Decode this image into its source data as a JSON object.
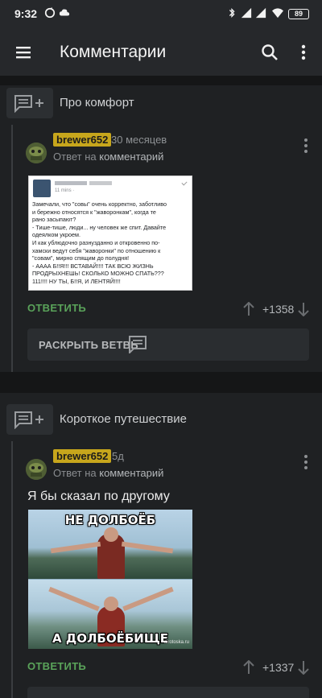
{
  "status_bar": {
    "time": "9:32",
    "battery": "89"
  },
  "app_bar": {
    "title": "Комментарии"
  },
  "threads": [
    {
      "topic": "Про комфорт",
      "comment": {
        "username": "brewer652",
        "time_ago": "30 месяцев",
        "reply_prefix": "Ответ на",
        "reply_target": "комментарий",
        "image": {
          "type": "screenshot-of-social-post",
          "post_time": "11 mins ·",
          "text_lines": [
            "Замечали, что \"совы\" очень корректно, заботливо",
            "и бережно относятся к \"жаворонкам\", когда те",
            "рано засыпают?",
            "- Тише-тише, люди... ну человек же спит. Давайте",
            "одеялком укроем.",
            "И как ублюдочно разнузданно и откровенно по-",
            "хамски ведут себя \"жаворонки\" по отношению к",
            "\"совам\", мирно спящим до полудня!",
            "- АААА Б!!Я!!! ВСТАВАЙ!!!! ТАК ВСЮ ЖИЗНЬ",
            "ПРОДРЫХНЕШЬ! СКОЛЬКО МОЖНО СПАТЬ???",
            "111!!!! НУ ТЫ, Б!!Я, И ЛЕНТЯЙ!!!!"
          ]
        },
        "reply_label": "ОТВЕТИТЬ",
        "votes": "+1358"
      },
      "expand_label": "РАСКРЫТЬ ВЕТВЬ"
    },
    {
      "topic": "Короткое путешествие",
      "comment": {
        "username": "brewer652",
        "time_ago": "5д",
        "reply_prefix": "Ответ на",
        "reply_target": "комментарий",
        "text": "Я бы сказал по другому",
        "image": {
          "type": "meme",
          "top_caption": "НЕ ДОЛБОЁБ",
          "bottom_caption": "А ДОЛБОЁБИЩЕ",
          "watermark": "sirotoska.ru"
        },
        "reply_label": "ОТВЕТИТЬ",
        "votes": "+1337"
      }
    }
  ]
}
